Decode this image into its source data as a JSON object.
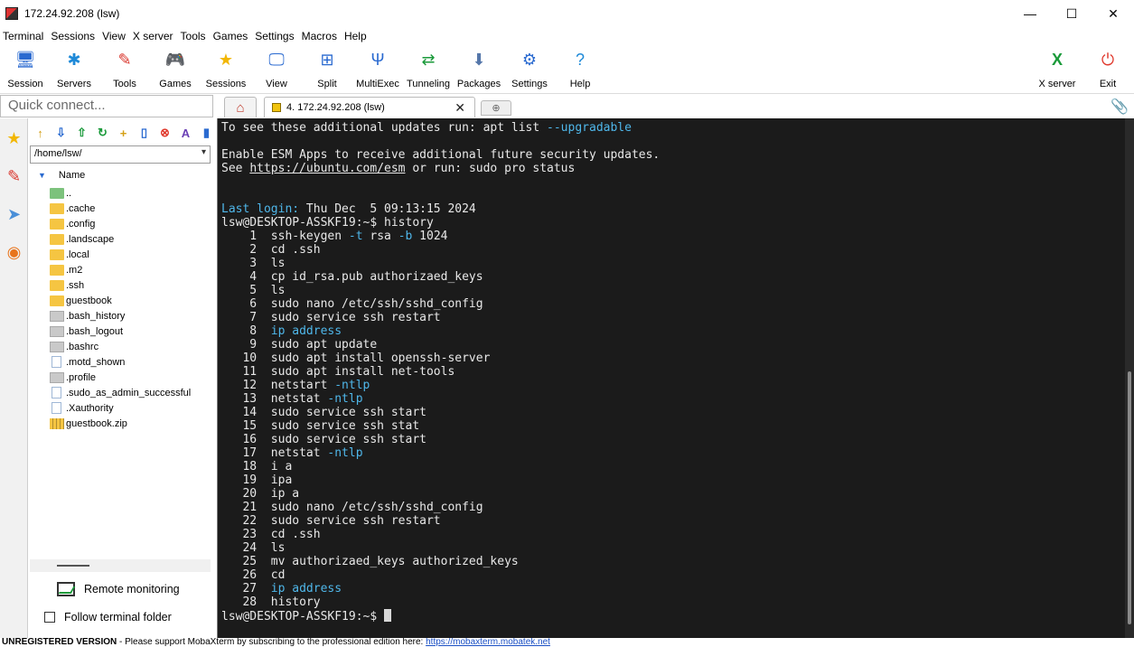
{
  "window": {
    "title": "172.24.92.208 (lsw)",
    "minimize_glyph": "—",
    "maximize_glyph": "☐",
    "close_glyph": "✕"
  },
  "menu": [
    "Terminal",
    "Sessions",
    "View",
    "X server",
    "Tools",
    "Games",
    "Settings",
    "Macros",
    "Help"
  ],
  "toolbar": {
    "left": [
      {
        "label": "Session",
        "icon": "session-icon",
        "glyph": "🖥",
        "color": "#2a6ad0"
      },
      {
        "label": "Servers",
        "icon": "servers-icon",
        "glyph": "✱",
        "color": "#1f8ad8"
      },
      {
        "label": "Tools",
        "icon": "tools-icon",
        "glyph": "✎",
        "color": "#d9342b"
      },
      {
        "label": "Games",
        "icon": "games-icon",
        "glyph": "🎮",
        "color": "#555555"
      },
      {
        "label": "Sessions",
        "icon": "sessions-star-icon",
        "glyph": "★",
        "color": "#f2b705"
      },
      {
        "label": "View",
        "icon": "view-icon",
        "glyph": "🖵",
        "color": "#2a6ad0"
      },
      {
        "label": "Split",
        "icon": "split-icon",
        "glyph": "⊞",
        "color": "#2a6ad0"
      },
      {
        "label": "MultiExec",
        "icon": "multiexec-icon",
        "glyph": "Ψ",
        "color": "#2a6ad0"
      },
      {
        "label": "Tunneling",
        "icon": "tunneling-icon",
        "glyph": "⇄",
        "color": "#1a9a3a"
      },
      {
        "label": "Packages",
        "icon": "packages-icon",
        "glyph": "⬇",
        "color": "#5577aa"
      },
      {
        "label": "Settings",
        "icon": "settings-icon",
        "glyph": "⚙",
        "color": "#2a6ad0"
      },
      {
        "label": "Help",
        "icon": "help-icon",
        "glyph": "?",
        "color": "#1f8ad8"
      }
    ],
    "right": [
      {
        "label": "X server",
        "icon": "x-server-icon",
        "glyph": "X",
        "color": "#1a9a3a"
      },
      {
        "label": "Exit",
        "icon": "exit-icon",
        "glyph": "⏻",
        "color": "#e03a2e"
      }
    ]
  },
  "quick_connect": {
    "placeholder": "Quick connect..."
  },
  "tabs": {
    "home_glyph": "⌂",
    "active_label": "4. 172.24.92.208 (lsw)",
    "close_glyph": "✕",
    "new_tab_glyph": "⊕",
    "attach_glyph": "📎"
  },
  "left_rail": [
    {
      "icon": "favorites-star-icon",
      "glyph": "★",
      "color": "#f2b705"
    },
    {
      "icon": "tools-rail-icon",
      "glyph": "✎",
      "color": "#d9342b"
    },
    {
      "icon": "send-icon",
      "glyph": "➤",
      "color": "#4a8fd8"
    },
    {
      "icon": "globe-icon",
      "glyph": "◉",
      "color": "#e8741c"
    }
  ],
  "sidebar": {
    "tools": [
      {
        "icon": "folder-up-icon",
        "glyph": "↑",
        "color": "#d4a017"
      },
      {
        "icon": "download-icon",
        "glyph": "⇩",
        "color": "#2a6ad0"
      },
      {
        "icon": "upload-icon",
        "glyph": "⇧",
        "color": "#1a9a3a"
      },
      {
        "icon": "refresh-icon",
        "glyph": "↻",
        "color": "#1a9a3a"
      },
      {
        "icon": "new-folder-icon",
        "glyph": "+",
        "color": "#d4a017"
      },
      {
        "icon": "new-file-icon",
        "glyph": "▯",
        "color": "#2a6ad0"
      },
      {
        "icon": "delete-icon",
        "glyph": "⊗",
        "color": "#e03a2e"
      },
      {
        "icon": "rename-icon",
        "glyph": "A",
        "color": "#6a3fb5"
      },
      {
        "icon": "properties-icon",
        "glyph": "▮",
        "color": "#2a6ad0"
      }
    ],
    "path": "/home/lsw/",
    "column_header": "Name",
    "files": [
      {
        "name": "..",
        "type": "up"
      },
      {
        "name": ".cache",
        "type": "folder"
      },
      {
        "name": ".config",
        "type": "folder"
      },
      {
        "name": ".landscape",
        "type": "folder"
      },
      {
        "name": ".local",
        "type": "folder"
      },
      {
        "name": ".m2",
        "type": "folder"
      },
      {
        "name": ".ssh",
        "type": "folder"
      },
      {
        "name": "guestbook",
        "type": "folder"
      },
      {
        "name": ".bash_history",
        "type": "gray"
      },
      {
        "name": ".bash_logout",
        "type": "gray"
      },
      {
        "name": ".bashrc",
        "type": "gray"
      },
      {
        "name": ".motd_shown",
        "type": "doc"
      },
      {
        "name": ".profile",
        "type": "gray"
      },
      {
        "name": ".sudo_as_admin_successful",
        "type": "doc"
      },
      {
        "name": ".Xauthority",
        "type": "doc"
      },
      {
        "name": "guestbook.zip",
        "type": "zip"
      }
    ],
    "remote_monitoring": "Remote monitoring",
    "follow_terminal_folder": "Follow terminal folder"
  },
  "terminal": {
    "lines": [
      [
        {
          "t": "To see these additional updates run: apt list "
        },
        {
          "t": "--upgradable",
          "c": "cyan"
        }
      ],
      [
        {
          "t": ""
        }
      ],
      [
        {
          "t": "Enable ESM Apps to receive additional future security updates."
        }
      ],
      [
        {
          "t": "See "
        },
        {
          "t": "https://ubuntu.com/esm",
          "c": "link"
        },
        {
          "t": " or run: sudo pro status"
        }
      ],
      [
        {
          "t": ""
        }
      ],
      [
        {
          "t": ""
        }
      ],
      [
        {
          "t": "Last login:",
          "c": "cyan"
        },
        {
          "t": " Thu Dec  5 09:13:15 2024"
        }
      ],
      [
        {
          "t": "lsw@DESKTOP-ASSKF19:~$ history"
        }
      ],
      [
        {
          "t": "    1  ssh-keygen "
        },
        {
          "t": "-t",
          "c": "cyan"
        },
        {
          "t": " rsa "
        },
        {
          "t": "-b",
          "c": "cyan"
        },
        {
          "t": " 1024"
        }
      ],
      [
        {
          "t": "    2  cd .ssh"
        }
      ],
      [
        {
          "t": "    3  ls"
        }
      ],
      [
        {
          "t": "    4  cp id_rsa.pub authorizaed_keys"
        }
      ],
      [
        {
          "t": "    5  ls"
        }
      ],
      [
        {
          "t": "    6  sudo nano /etc/ssh/sshd_config"
        }
      ],
      [
        {
          "t": "    7  sudo service ssh restart"
        }
      ],
      [
        {
          "t": "    8  "
        },
        {
          "t": "ip address",
          "c": "cyan"
        }
      ],
      [
        {
          "t": "    9  sudo apt update"
        }
      ],
      [
        {
          "t": "   10  sudo apt install openssh-server"
        }
      ],
      [
        {
          "t": "   11  sudo apt install net-tools"
        }
      ],
      [
        {
          "t": "   12  netstart "
        },
        {
          "t": "-ntlp",
          "c": "cyan"
        }
      ],
      [
        {
          "t": "   13  netstat "
        },
        {
          "t": "-ntlp",
          "c": "cyan"
        }
      ],
      [
        {
          "t": "   14  sudo service ssh start"
        }
      ],
      [
        {
          "t": "   15  sudo service ssh stat"
        }
      ],
      [
        {
          "t": "   16  sudo service ssh start"
        }
      ],
      [
        {
          "t": "   17  netstat "
        },
        {
          "t": "-ntlp",
          "c": "cyan"
        }
      ],
      [
        {
          "t": "   18  i a"
        }
      ],
      [
        {
          "t": "   19  ipa"
        }
      ],
      [
        {
          "t": "   20  ip a"
        }
      ],
      [
        {
          "t": "   21  sudo nano /etc/ssh/sshd_config"
        }
      ],
      [
        {
          "t": "   22  sudo service ssh restart"
        }
      ],
      [
        {
          "t": "   23  cd .ssh"
        }
      ],
      [
        {
          "t": "   24  ls"
        }
      ],
      [
        {
          "t": "   25  mv authorizaed_keys authorized_keys"
        }
      ],
      [
        {
          "t": "   26  cd"
        }
      ],
      [
        {
          "t": "   27  "
        },
        {
          "t": "ip address",
          "c": "cyan"
        }
      ],
      [
        {
          "t": "   28  history"
        }
      ]
    ],
    "prompt": "lsw@DESKTOP-ASSKF19:~$ "
  },
  "statusbar": {
    "unregistered": "UNREGISTERED VERSION",
    "message": "  -  Please support MobaXterm by subscribing to the professional edition here:  ",
    "link": "https://mobaxterm.mobatek.net"
  },
  "colors": {
    "terminal_bg": "#1b1b1b",
    "terminal_fg": "#e8e8e8",
    "terminal_accent": "#4fb7ea"
  }
}
